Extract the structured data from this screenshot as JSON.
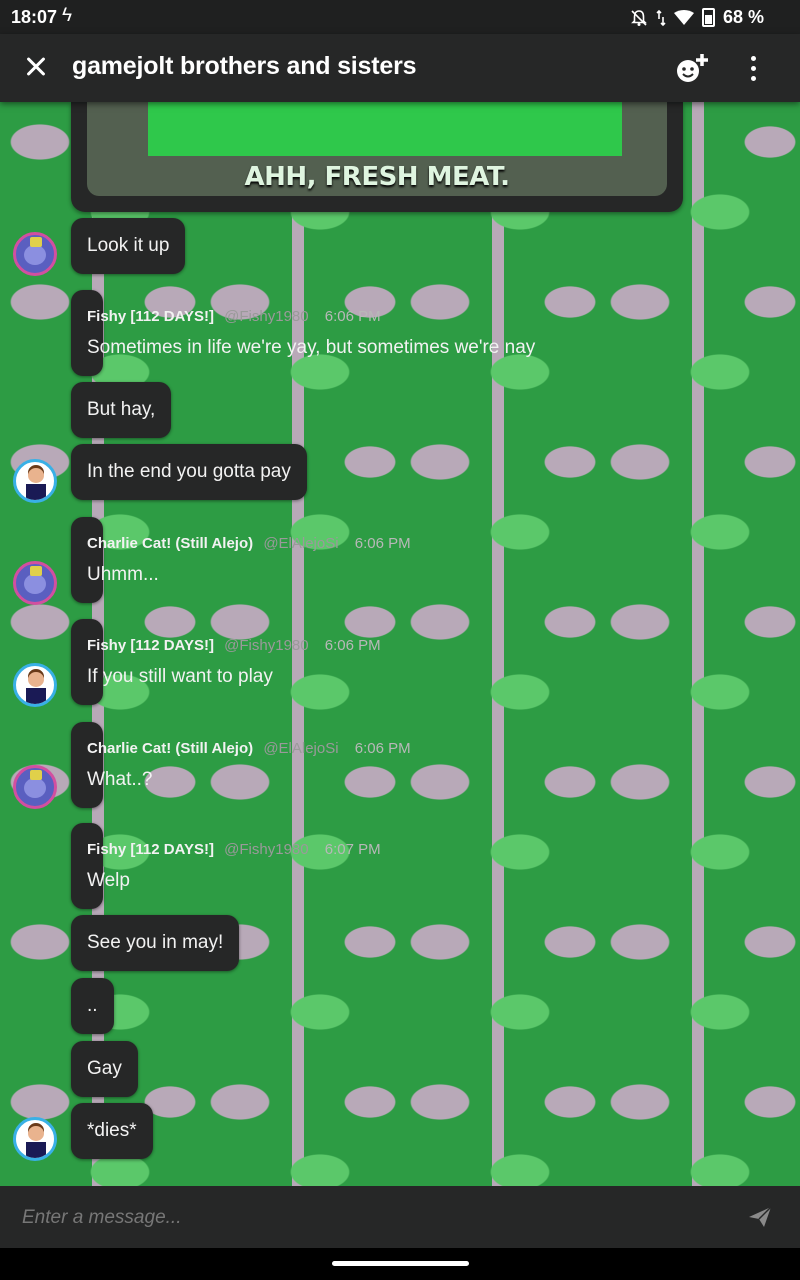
{
  "status_bar": {
    "time": "18:07",
    "flash_icon": "flash-icon",
    "battery_text": "68 %",
    "icons": [
      "notifications-off-icon",
      "data-arrows-icon",
      "wifi-icon",
      "battery-icon"
    ]
  },
  "header": {
    "title": "gamejolt brothers and sisters",
    "close_icon": "close-icon",
    "add_member_icon": "add-member-icon",
    "menu_icon": "kebab-menu-icon"
  },
  "image_message": {
    "caption": "AHH, FRESH MEAT."
  },
  "messages": [
    {
      "text": "Look it up"
    },
    {
      "user": "Fishy [112 DAYS!]",
      "handle": "@Fishy1980",
      "time": "6:06 PM",
      "text": "Sometimes in life we're yay, but sometimes we're nay"
    },
    {
      "text": "But hay,"
    },
    {
      "text": "In the end you gotta pay"
    },
    {
      "user": "Charlie Cat! (Still Alejo)",
      "handle": "@ElAlejoSi",
      "time": "6:06 PM",
      "text": "Uhmm..."
    },
    {
      "user": "Fishy [112 DAYS!]",
      "handle": "@Fishy1980",
      "time": "6:06 PM",
      "text": "If you still want to play"
    },
    {
      "user": "Charlie Cat! (Still Alejo)",
      "handle": "@ElAlejoSi",
      "time": "6:06 PM",
      "text": "What..?"
    },
    {
      "user": "Fishy [112 DAYS!]",
      "handle": "@Fishy1980",
      "time": "6:07 PM",
      "text": "Welp"
    },
    {
      "text": "See you in may!"
    },
    {
      "text": ".."
    },
    {
      "text": "Gay"
    },
    {
      "text": "*dies*"
    }
  ],
  "input": {
    "placeholder": "Enter a message...",
    "value": ""
  },
  "colors": {
    "bubble_bg": "#262727",
    "app_bar_bg": "#262727",
    "chat_bg": "#2d9c44"
  }
}
